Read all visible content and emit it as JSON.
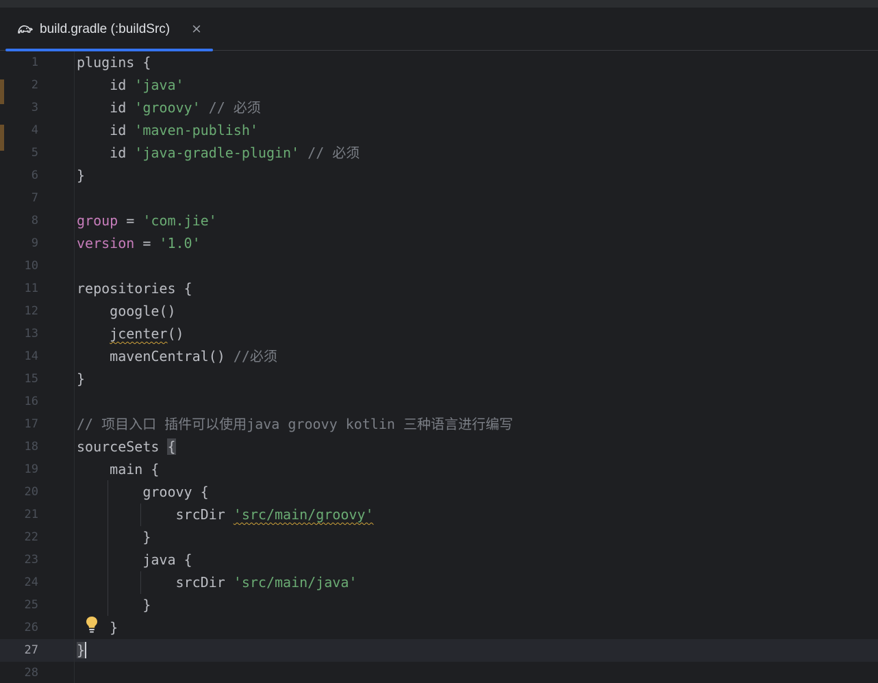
{
  "tab": {
    "title": "build.gradle (:buildSrc)",
    "close_glyph": "×",
    "icon": "gradle-elephant-icon",
    "accent": "#3574f0"
  },
  "editor": {
    "current_line": 27,
    "lines": [
      {
        "n": "1",
        "tokens": [
          {
            "text": "plugins {",
            "cls": "t-plain"
          }
        ]
      },
      {
        "n": "2",
        "tokens": [
          {
            "text": "    id ",
            "cls": "t-plain"
          },
          {
            "text": "'java'",
            "cls": "t-str"
          }
        ]
      },
      {
        "n": "3",
        "tokens": [
          {
            "text": "    id ",
            "cls": "t-plain"
          },
          {
            "text": "'groovy'",
            "cls": "t-str"
          },
          {
            "text": " // 必须",
            "cls": "t-comment"
          }
        ]
      },
      {
        "n": "4",
        "tokens": [
          {
            "text": "    id ",
            "cls": "t-plain"
          },
          {
            "text": "'maven-publish'",
            "cls": "t-str"
          }
        ]
      },
      {
        "n": "5",
        "tokens": [
          {
            "text": "    id ",
            "cls": "t-plain"
          },
          {
            "text": "'java-gradle-plugin'",
            "cls": "t-str"
          },
          {
            "text": " // 必须",
            "cls": "t-comment"
          }
        ]
      },
      {
        "n": "6",
        "tokens": [
          {
            "text": "}",
            "cls": "t-plain"
          }
        ]
      },
      {
        "n": "7",
        "tokens": []
      },
      {
        "n": "8",
        "tokens": [
          {
            "text": "group",
            "cls": "t-prop"
          },
          {
            "text": " = ",
            "cls": "t-plain"
          },
          {
            "text": "'com.jie'",
            "cls": "t-str"
          }
        ]
      },
      {
        "n": "9",
        "tokens": [
          {
            "text": "version",
            "cls": "t-prop"
          },
          {
            "text": " = ",
            "cls": "t-plain"
          },
          {
            "text": "'1.0'",
            "cls": "t-str"
          }
        ]
      },
      {
        "n": "10",
        "tokens": []
      },
      {
        "n": "11",
        "tokens": [
          {
            "text": "repositories {",
            "cls": "t-plain"
          }
        ]
      },
      {
        "n": "12",
        "tokens": [
          {
            "text": "    google()",
            "cls": "t-plain"
          }
        ]
      },
      {
        "n": "13",
        "tokens": [
          {
            "text": "    ",
            "cls": "t-plain"
          },
          {
            "text": "jcenter",
            "cls": "t-plain t-strike t-warn"
          },
          {
            "text": "()",
            "cls": "t-plain"
          }
        ]
      },
      {
        "n": "14",
        "tokens": [
          {
            "text": "    mavenCentral() ",
            "cls": "t-plain"
          },
          {
            "text": "//必须",
            "cls": "t-comment"
          }
        ]
      },
      {
        "n": "15",
        "tokens": [
          {
            "text": "}",
            "cls": "t-plain"
          }
        ]
      },
      {
        "n": "16",
        "tokens": []
      },
      {
        "n": "17",
        "tokens": [
          {
            "text": "// 项目入口 插件可以使用java groovy kotlin 三种语言进行编写",
            "cls": "t-comment"
          }
        ]
      },
      {
        "n": "18",
        "tokens": [
          {
            "text": "sourceSets ",
            "cls": "t-plain"
          },
          {
            "text": "{",
            "cls": "t-plain t-brace-hl"
          }
        ]
      },
      {
        "n": "19",
        "tokens": [
          {
            "text": "    main {",
            "cls": "t-plain"
          }
        ]
      },
      {
        "n": "20",
        "tokens": [
          {
            "text": "        groovy {",
            "cls": "t-plain"
          }
        ]
      },
      {
        "n": "21",
        "tokens": [
          {
            "text": "            srcDir ",
            "cls": "t-plain"
          },
          {
            "text": "'src/main/groovy'",
            "cls": "t-str t-warn"
          }
        ]
      },
      {
        "n": "22",
        "tokens": [
          {
            "text": "        }",
            "cls": "t-plain"
          }
        ]
      },
      {
        "n": "23",
        "tokens": [
          {
            "text": "        java {",
            "cls": "t-plain"
          }
        ]
      },
      {
        "n": "24",
        "tokens": [
          {
            "text": "            srcDir ",
            "cls": "t-plain"
          },
          {
            "text": "'src/main/java'",
            "cls": "t-str"
          }
        ]
      },
      {
        "n": "25",
        "tokens": [
          {
            "text": "        }",
            "cls": "t-plain"
          }
        ]
      },
      {
        "n": "26",
        "tokens": [
          {
            "text": "    }",
            "cls": "t-plain"
          }
        ]
      },
      {
        "n": "27",
        "tokens": [
          {
            "text": "}",
            "cls": "t-plain t-caret"
          }
        ]
      },
      {
        "n": "28",
        "tokens": []
      }
    ]
  },
  "gutter": {
    "intention_icon": "lightbulb-icon"
  },
  "colors": {
    "background": "#1e1f22",
    "string": "#6aab73",
    "comment": "#7a7e85",
    "property": "#c77dbb",
    "text": "#bcbec4"
  }
}
